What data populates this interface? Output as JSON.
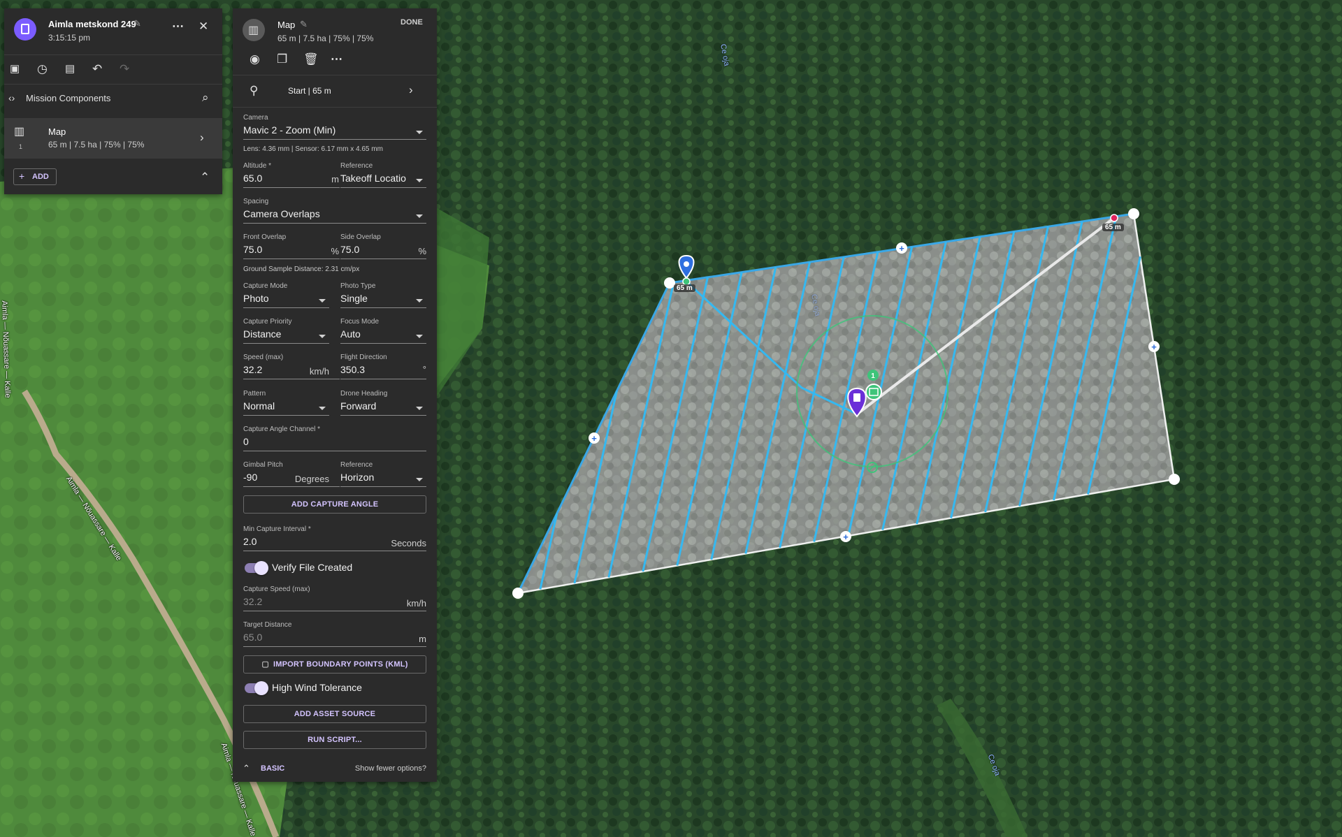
{
  "mission": {
    "title": "Aimla metskond 249",
    "time": "3:15:15 pm",
    "components_label": "Mission Components",
    "component": {
      "index": "1",
      "name": "Map",
      "summary": "65 m | 7.5 ha | 75% | 75%"
    },
    "add_label": "ADD"
  },
  "editor": {
    "title": "Map",
    "summary": "65 m | 7.5 ha | 75% | 75%",
    "done_label": "DONE",
    "start_label": "Start | 65 m",
    "camera": {
      "label": "Camera",
      "value": "Mavic 2 - Zoom (Min)",
      "info": "Lens: 4.36 mm | Sensor: 6.17 mm x 4.65 mm"
    },
    "altitude": {
      "label": "Altitude *",
      "value": "65.0",
      "unit": "m"
    },
    "altitude_ref": {
      "label": "Reference",
      "value": "Takeoff Locatio"
    },
    "spacing": {
      "label": "Spacing",
      "value": "Camera Overlaps"
    },
    "front_overlap": {
      "label": "Front Overlap",
      "value": "75.0",
      "unit": "%"
    },
    "side_overlap": {
      "label": "Side Overlap",
      "value": "75.0",
      "unit": "%"
    },
    "gsd": "Ground Sample Distance: 2.31 cm/px",
    "capture_mode": {
      "label": "Capture Mode",
      "value": "Photo"
    },
    "photo_type": {
      "label": "Photo Type",
      "value": "Single"
    },
    "capture_priority": {
      "label": "Capture Priority",
      "value": "Distance"
    },
    "focus_mode": {
      "label": "Focus Mode",
      "value": "Auto"
    },
    "speed": {
      "label": "Speed (max)",
      "value": "32.2",
      "unit": "km/h"
    },
    "flight_direction": {
      "label": "Flight Direction",
      "value": "350.3",
      "unit": "°"
    },
    "pattern": {
      "label": "Pattern",
      "value": "Normal"
    },
    "drone_heading": {
      "label": "Drone Heading",
      "value": "Forward"
    },
    "capture_angle_channel": {
      "label": "Capture Angle Channel *",
      "value": "0"
    },
    "gimbal_pitch": {
      "label": "Gimbal Pitch",
      "value": "-90",
      "unit": "Degrees"
    },
    "gimbal_ref": {
      "label": "Reference",
      "value": "Horizon"
    },
    "add_capture_angle": "ADD CAPTURE ANGLE",
    "min_capture_interval": {
      "label": "Min Capture Interval *",
      "value": "2.0",
      "unit": "Seconds"
    },
    "verify_file_created": {
      "label": "Verify File Created",
      "on": true
    },
    "capture_speed": {
      "label": "Capture Speed (max)",
      "value": "32.2",
      "unit": "km/h"
    },
    "target_distance": {
      "label": "Target Distance",
      "value": "65.0",
      "unit": "m"
    },
    "import_kml": "IMPORT BOUNDARY POINTS (KML)",
    "high_wind": {
      "label": "High Wind Tolerance",
      "on": true
    },
    "add_asset_source": "ADD ASSET SOURCE",
    "run_script": "RUN SCRIPT...",
    "basic_label": "BASIC",
    "fewer_options": "Show fewer options?"
  },
  "map": {
    "road_labels": [
      "Aimla — Nõuassare — Kalle",
      "Aimla — Nõuassare — Kalle",
      "Aimla — Nõuassare — Kalle"
    ],
    "water_labels": [
      "Ce oja",
      "Ce oja",
      "Ce oja"
    ],
    "altitude_tags": [
      "65 m",
      "65 m"
    ],
    "waypoint_number": "1"
  },
  "colors": {
    "accent": "#7b5cff",
    "panel": "#2b2b2b",
    "flight_line": "#35b8f0",
    "boundary_edge": "#3aa7e6",
    "green_marker": "#3ec47a",
    "end_marker": "#e0245e"
  }
}
